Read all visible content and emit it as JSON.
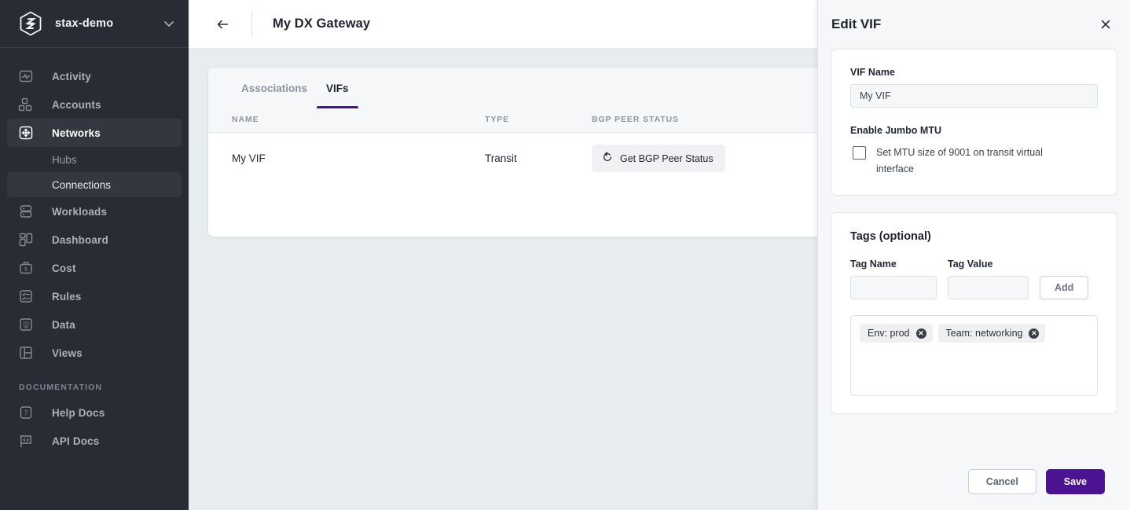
{
  "sidebar": {
    "org_name": "stax-demo",
    "logo_icon": "stax-hexagon-logo",
    "caret_icon": "chevron-down-icon",
    "items": [
      {
        "label": "Activity",
        "icon": "activity-chart-icon",
        "active": false
      },
      {
        "label": "Accounts",
        "icon": "accounts-grid-icon",
        "active": false
      },
      {
        "label": "Networks",
        "icon": "networks-move-icon",
        "active": true
      },
      {
        "label": "Workloads",
        "icon": "workloads-stack-icon",
        "active": false
      },
      {
        "label": "Dashboard",
        "icon": "dashboard-grid-icon",
        "active": false
      },
      {
        "label": "Cost",
        "icon": "cost-briefcase-icon",
        "active": false
      },
      {
        "label": "Rules",
        "icon": "rules-checklist-icon",
        "active": false
      },
      {
        "label": "Data",
        "icon": "data-binary-icon",
        "active": false
      },
      {
        "label": "Views",
        "icon": "views-layout-icon",
        "active": false
      }
    ],
    "sub_items": [
      {
        "label": "Hubs",
        "active": false
      },
      {
        "label": "Connections",
        "active": true
      }
    ],
    "section_label": "DOCUMENTATION",
    "doc_items": [
      {
        "label": "Help Docs",
        "icon": "help-question-icon"
      },
      {
        "label": "API Docs",
        "icon": "api-flag-code-icon"
      }
    ]
  },
  "topbar": {
    "back_icon": "arrow-left-icon",
    "title": "My DX Gateway"
  },
  "main": {
    "tabs": [
      {
        "label": "Associations",
        "active": false
      },
      {
        "label": "VIFs",
        "active": true
      }
    ],
    "table": {
      "columns": [
        "NAME",
        "TYPE",
        "BGP PEER STATUS"
      ],
      "rows": [
        {
          "name": "My VIF",
          "type": "Transit",
          "bgp_button": "Get BGP Peer Status",
          "bgp_icon": "refresh-counterclockwise-icon"
        }
      ]
    }
  },
  "drawer": {
    "title": "Edit VIF",
    "close_icon": "close-icon",
    "vif_name": {
      "label": "VIF Name",
      "value": "My VIF",
      "placeholder": "My VIF"
    },
    "jumbo_mtu": {
      "label": "Enable Jumbo MTU",
      "checkbox_label": "Set MTU size of 9001 on transit virtual interface",
      "checked": false
    },
    "tags": {
      "title": "Tags (optional)",
      "name_label": "Tag Name",
      "name_value": "",
      "name_placeholder": "",
      "value_label": "Tag Value",
      "value_value": "",
      "value_placeholder": "",
      "add_label": "Add",
      "chips": [
        {
          "text": "Env: prod",
          "remove_icon": "remove-chip-icon"
        },
        {
          "text": "Team: networking",
          "remove_icon": "remove-chip-icon"
        }
      ]
    },
    "footer": {
      "cancel_label": "Cancel",
      "save_label": "Save"
    }
  },
  "colors": {
    "accent_purple": "#4b1391",
    "sidebar_bg": "#282c34",
    "page_bg": "#e7ecee",
    "panel_bg": "#f5f7f9"
  }
}
